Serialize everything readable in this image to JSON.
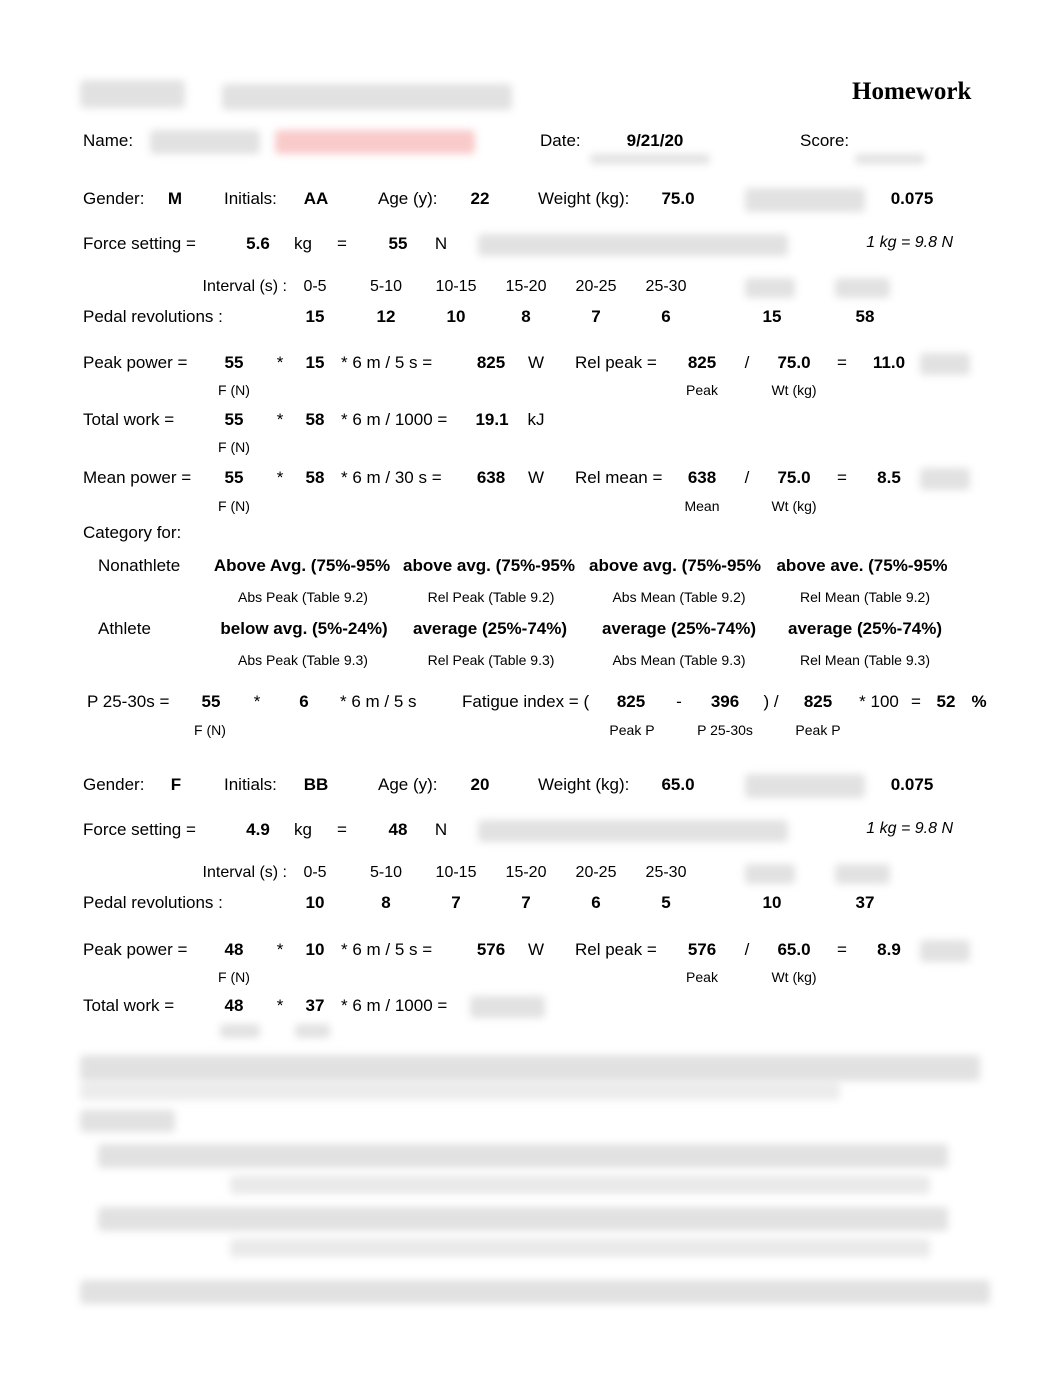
{
  "header": {
    "title": "Homework",
    "name_label": "Name:",
    "date_label": "Date:",
    "date": "9/21/20",
    "score_label": "Score:"
  },
  "labels": {
    "gender": "Gender:",
    "initials": "Initials:",
    "age": "Age (y):",
    "weight": "Weight (kg):",
    "force_setting": "Force setting  =",
    "kg": "kg",
    "eq": "=",
    "n": "N",
    "conversion": "1 kg = 9.8 N",
    "interval": "Interval (s) :",
    "intervals": [
      "0-5",
      "5-10",
      "10-15",
      "15-20",
      "20-25",
      "25-30"
    ],
    "pedal": "Pedal revolutions :",
    "peak_power": "Peak power  =",
    "star": "*",
    "peak_formula": "* 6 m / 5 s =",
    "w": "W",
    "rel_peak": "Rel peak  =",
    "slash": "/",
    "f_n": "F (N)",
    "peak": "Peak",
    "wt_kg": "Wt (kg)",
    "total_work": "Total work  =",
    "work_formula": "* 6 m / 1000 =",
    "kj": "kJ",
    "mean_power": "Mean power  =",
    "mean_formula": "* 6 m / 30 s =",
    "rel_mean": "Rel mean  =",
    "mean": "Mean",
    "category_for": "Category for:",
    "nonathlete": "Nonathlete",
    "athlete": "Athlete",
    "p2530": "P 25-30s =",
    "p_formula": "* 6 m / 5 s",
    "fatigue": "Fatigue index = (",
    "minus": "-",
    "close_slash": ") /",
    "times100": "* 100",
    "pct": "%",
    "peak_p": "Peak P",
    "p_25_30s": "P 25-30s",
    "nonathlete_tables": [
      "Abs Peak (Table 9.2)",
      "Rel Peak (Table 9.2)",
      "Abs Mean (Table 9.2)",
      "Rel Mean (Table 9.2)"
    ],
    "athlete_tables": [
      "Abs Peak (Table 9.3)",
      "Rel Peak (Table 9.3)",
      "Abs Mean (Table 9.3)",
      "Rel Mean (Table 9.3)"
    ]
  },
  "subject1": {
    "gender": "M",
    "initials": "AA",
    "age": "22",
    "weight": "75.0",
    "factor": "0.075",
    "force_kg": "5.6",
    "force_n": "55",
    "revs": [
      "15",
      "12",
      "10",
      "8",
      "7",
      "6"
    ],
    "revs_first5": "15",
    "revs_total": "58",
    "peak_f": "55",
    "peak_revs": "15",
    "peak_power": "825",
    "rel_peak_num": "825",
    "rel_peak_wt": "75.0",
    "rel_peak": "11.0",
    "work_f": "55",
    "work_revs": "58",
    "total_work": "19.1",
    "mean_f": "55",
    "mean_revs": "58",
    "mean_power": "638",
    "rel_mean_num": "638",
    "rel_mean_wt": "75.0",
    "rel_mean": "8.5",
    "nonathlete_cats": [
      "Above Avg. (75%-95%",
      "above avg. (75%-95%",
      "above avg. (75%-95%",
      "above ave. (75%-95%"
    ],
    "athlete_cats": [
      "below avg. (5%-24%)",
      "average (25%-74%)",
      "average (25%-74%)",
      "average (25%-74%)"
    ],
    "p_f": "55",
    "p_revs": "6",
    "fi_peak": "825",
    "fi_p2530": "396",
    "fi_peak2": "825",
    "fatigue_index": "52"
  },
  "subject2": {
    "gender": "F",
    "initials": "BB",
    "age": "20",
    "weight": "65.0",
    "factor": "0.075",
    "force_kg": "4.9",
    "force_n": "48",
    "revs": [
      "10",
      "8",
      "7",
      "7",
      "6",
      "5"
    ],
    "revs_first5": "10",
    "revs_total": "37",
    "peak_f": "48",
    "peak_revs": "10",
    "peak_power": "576",
    "rel_peak_num": "576",
    "rel_peak_wt": "65.0",
    "rel_peak": "8.9",
    "work_f": "48",
    "work_revs": "37"
  }
}
